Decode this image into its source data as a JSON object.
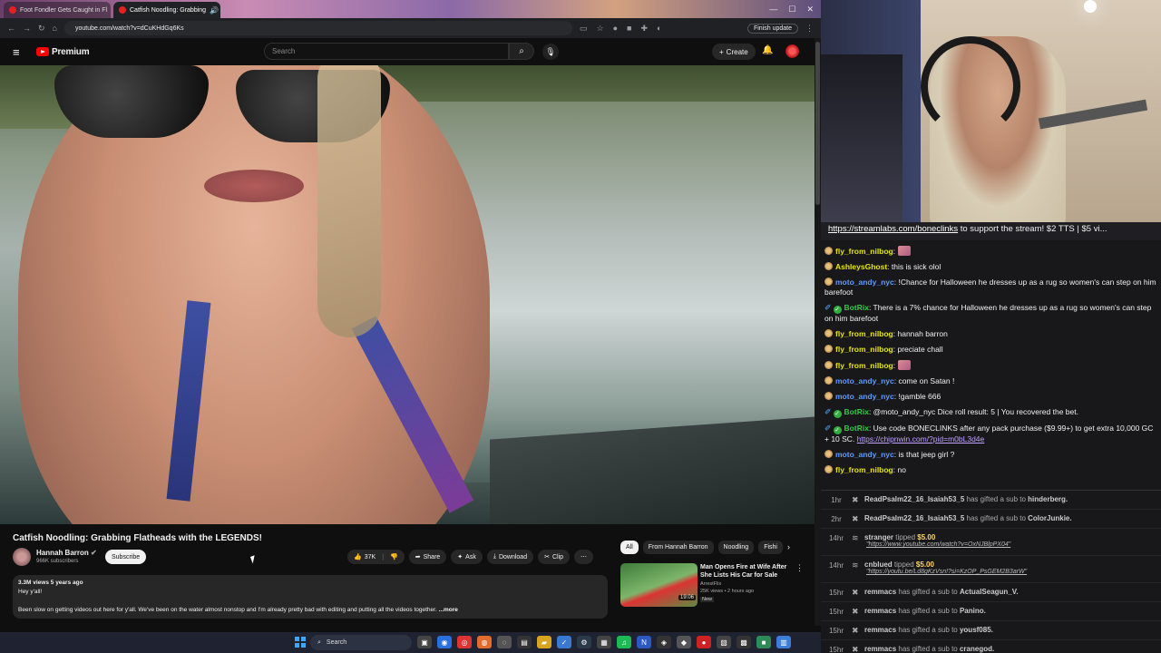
{
  "browser": {
    "tabs": [
      {
        "title": "Foot Fondler Gets Caught in Fl",
        "active": false
      },
      {
        "title": "Catfish Noodling: Grabbing",
        "active": true
      }
    ],
    "url": "youtube.com/watch?v=dCuKHdGq6Ks",
    "update_label": "Finish update"
  },
  "youtube": {
    "logo_text": "Premium",
    "search_placeholder": "Search",
    "create_label": "Create",
    "video": {
      "title": "Catfish Noodling: Grabbing Flatheads with the LEGENDS!",
      "channel": "Hannah Barron",
      "subscribers": "966K subscribers",
      "subscribe_label": "Subscribe",
      "likes": "37K",
      "share_label": "Share",
      "ask_label": "Ask",
      "download_label": "Download",
      "clip_label": "Clip",
      "desc_meta": "3.3M views  5 years ago",
      "desc_line1": "Hey y'all!",
      "desc_line2": "Been slow on getting videos out here for y'all. We've been on the water almost nonstop and I'm already pretty bad with editing and putting all the videos together.",
      "desc_more": "...more"
    },
    "chips": [
      "All",
      "From Hannah Barron",
      "Noodling",
      "Fishi"
    ],
    "recommendation": {
      "title": "Man Opens Fire at Wife After She Lists His Car for Sale",
      "channel": "ArrestFlix",
      "meta": "25K views • 2 hours ago",
      "badge": "New",
      "duration": "19:06"
    }
  },
  "stream": {
    "banner_link": "https://streamlabs.com/boneclinks",
    "banner_text": " to support the stream! $2 TTS | $5 vi..."
  },
  "chat": [
    {
      "user": "fly_from_nilbog",
      "text": "",
      "color": "#e6e600",
      "emote": true,
      "bot": false
    },
    {
      "user": "AshleysGhost",
      "text": "this is sick olol",
      "color": "#e6e600",
      "emote": false,
      "bot": false
    },
    {
      "user": "moto_andy_nyc",
      "text": "!Chance for Halloween he dresses up as a rug so women's can step on him barefoot",
      "color": "#5e9cff",
      "emote": false,
      "bot": false
    },
    {
      "user": "BotRix",
      "text": "There is a 7% chance for Halloween he dresses up as a rug so women's can step on him barefoot",
      "color": "#2ecc40",
      "emote": false,
      "bot": true
    },
    {
      "user": "fly_from_nilbog",
      "text": "hannah barron",
      "color": "#e6e600",
      "emote": false,
      "bot": false
    },
    {
      "user": "fly_from_nilbog",
      "text": "preciate chall",
      "color": "#e6e600",
      "emote": false,
      "bot": false
    },
    {
      "user": "fly_from_nilbog",
      "text": "",
      "color": "#e6e600",
      "emote": true,
      "bot": false
    },
    {
      "user": "moto_andy_nyc",
      "text": "come on Satan !",
      "color": "#5e9cff",
      "emote": false,
      "bot": false
    },
    {
      "user": "moto_andy_nyc",
      "text": "!gamble 666",
      "color": "#5e9cff",
      "emote": false,
      "bot": false
    },
    {
      "user": "BotRix",
      "text": "@moto_andy_nyc Dice roll result: 5 | You recovered the bet.",
      "color": "#2ecc40",
      "emote": false,
      "bot": true
    },
    {
      "user": "BotRix",
      "text": "Use code BONECLINKS after any pack purchase ($9.99+) to get extra 10,000 GC + 10 SC.",
      "link": "https://chipnwin.com/?pid=m0bL3d4e",
      "color": "#2ecc40",
      "emote": false,
      "bot": true
    },
    {
      "user": "moto_andy_nyc",
      "text": "is that jeep girl ?",
      "color": "#5e9cff",
      "emote": false,
      "bot": false
    },
    {
      "user": "fly_from_nilbog",
      "text": "no",
      "color": "#e6e600",
      "emote": false,
      "bot": false
    }
  ],
  "events": [
    {
      "time": "1hr",
      "name": "ReadPsalm22_16_Isaiah53_5",
      "text": " has gifted a sub to ",
      "target": "hinderberg."
    },
    {
      "time": "2hr",
      "name": "ReadPsalm22_16_Isaiah53_5",
      "text": " has gifted a sub to ",
      "target": "ColorJunkie."
    },
    {
      "time": "14hr",
      "name": "stranger",
      "text": " tipped ",
      "amount": "$5.00",
      "message": "\"https://www.youtube.com/watch?v=OxNJBlpPX04\""
    },
    {
      "time": "14hr",
      "name": "cnblued",
      "text": " tipped ",
      "amount": "$5.00",
      "message": "\"https://youtu.be/Ld8gKzVsn!?si=KzOP_PsGEM2B3arW\""
    },
    {
      "time": "15hr",
      "name": "remmacs",
      "text": " has gifted a sub to ",
      "target": "ActualSeagun_V."
    },
    {
      "time": "15hr",
      "name": "remmacs",
      "text": " has gifted a sub to ",
      "target": "Panino."
    },
    {
      "time": "15hr",
      "name": "remmacs",
      "text": " has gifted a sub to ",
      "target": "yousf085."
    },
    {
      "time": "15hr",
      "name": "remmacs",
      "text": " has gifted a sub to ",
      "target": "cranegod."
    }
  ],
  "taskbar": {
    "search_label": "Search"
  }
}
